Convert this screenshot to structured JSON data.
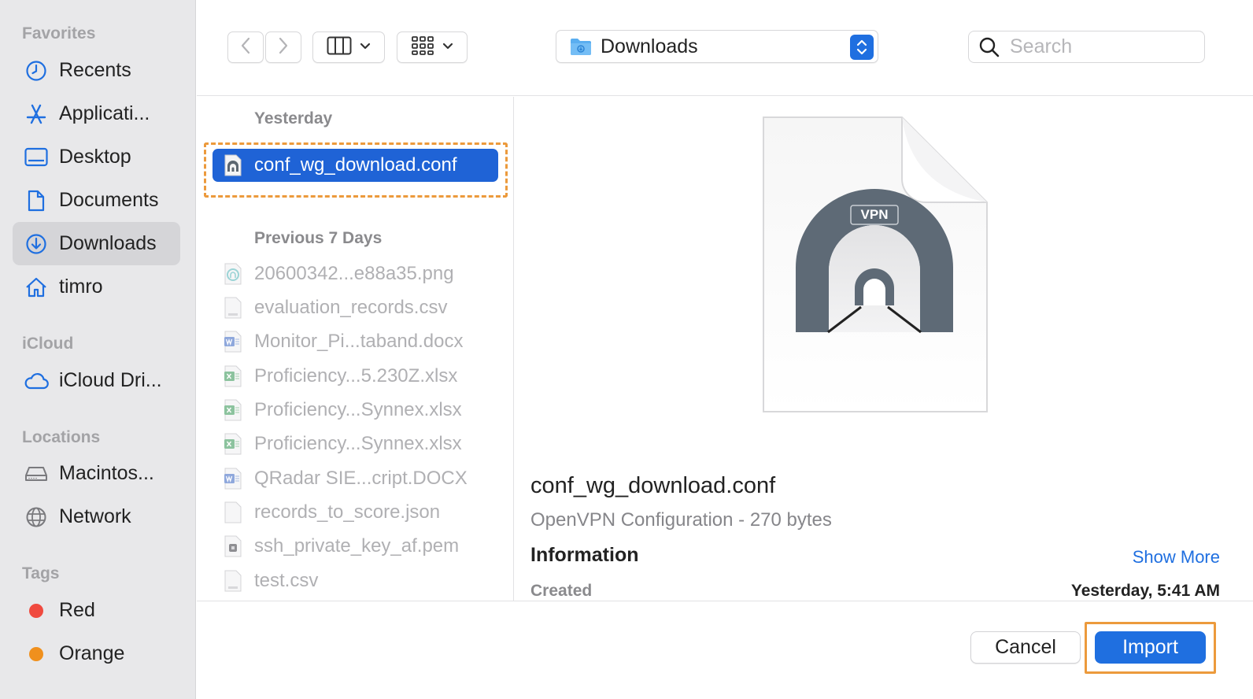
{
  "sidebar": {
    "favorites_header": "Favorites",
    "favorites": [
      {
        "label": "Recents",
        "icon": "clock-icon"
      },
      {
        "label": "Applicati...",
        "icon": "applications-icon"
      },
      {
        "label": "Desktop",
        "icon": "desktop-icon"
      },
      {
        "label": "Documents",
        "icon": "document-icon"
      },
      {
        "label": "Downloads",
        "icon": "downloads-icon",
        "selected": true
      },
      {
        "label": "timro",
        "icon": "home-icon"
      }
    ],
    "icloud_header": "iCloud",
    "icloud": [
      {
        "label": "iCloud Dri...",
        "icon": "cloud-icon"
      }
    ],
    "locations_header": "Locations",
    "locations": [
      {
        "label": "Macintos...",
        "icon": "hard-drive-icon"
      },
      {
        "label": "Network",
        "icon": "globe-icon"
      }
    ],
    "tags_header": "Tags",
    "tags": [
      {
        "label": "Red",
        "color": "#f04a3f"
      },
      {
        "label": "Orange",
        "color": "#f0901d"
      }
    ]
  },
  "toolbar": {
    "back_icon": "chevron-left-icon",
    "forward_icon": "chevron-right-icon",
    "view_icon": "columns-icon",
    "group_icon": "grid-icon",
    "current_folder": "Downloads",
    "search_placeholder": "Search"
  },
  "file_list": {
    "group_yesterday": "Yesterday",
    "selected_file": "conf_wg_download.conf",
    "group_previous": "Previous 7 Days",
    "files": [
      {
        "name": "20600342...e88a35.png",
        "type": "png"
      },
      {
        "name": "evaluation_records.csv",
        "type": "csv"
      },
      {
        "name": "Monitor_Pi...taband.docx",
        "type": "docx"
      },
      {
        "name": "Proficiency...5.230Z.xlsx",
        "type": "xlsx"
      },
      {
        "name": "Proficiency...Synnex.xlsx",
        "type": "xlsx"
      },
      {
        "name": "Proficiency...Synnex.xlsx",
        "type": "xlsx"
      },
      {
        "name": "QRadar SIE...cript.DOCX",
        "type": "docx"
      },
      {
        "name": "records_to_score.json",
        "type": "json"
      },
      {
        "name": "ssh_private_key_af.pem",
        "type": "pem"
      },
      {
        "name": "test.csv",
        "type": "csv"
      }
    ]
  },
  "preview": {
    "badge": "VPN",
    "name": "conf_wg_download.conf",
    "kind": "OpenVPN Configuration - 270 bytes",
    "info_header": "Information",
    "show_more": "Show More",
    "created_label": "Created",
    "created_value": "Yesterday, 5:41 AM"
  },
  "footer": {
    "cancel": "Cancel",
    "import": "Import"
  },
  "colors": {
    "accent": "#1f6fe0",
    "selection": "#1f63d6",
    "highlight": "#ec9a3c"
  }
}
